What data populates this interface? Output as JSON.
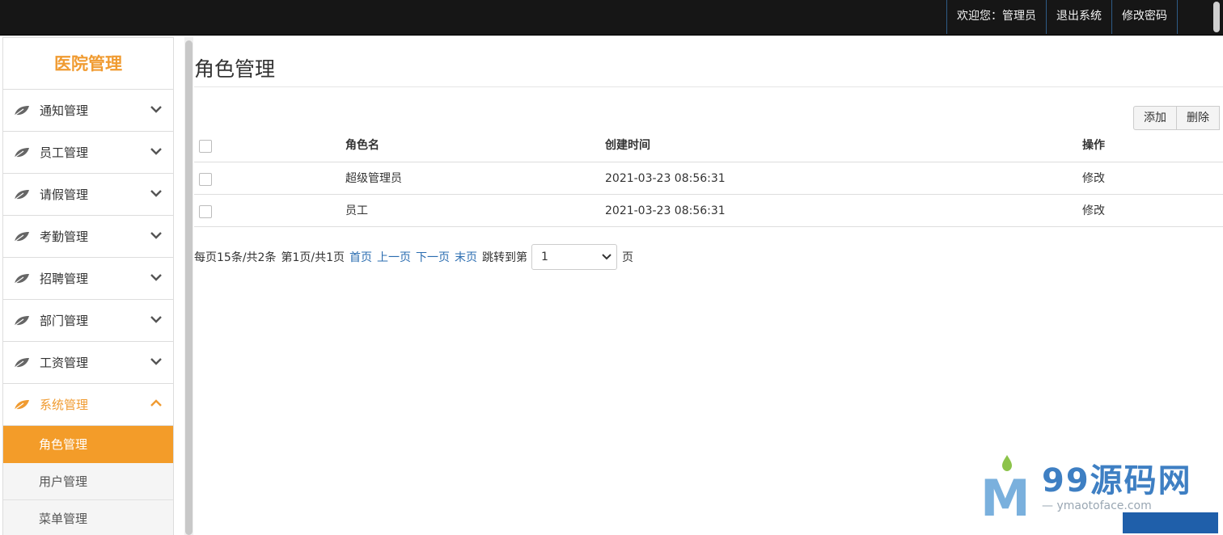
{
  "topbar": {
    "welcome": "欢迎您：管理员",
    "logout": "退出系统",
    "change_password": "修改密码"
  },
  "sidebar": {
    "brand": "医院管理",
    "items": [
      {
        "label": "通知管理",
        "icon": "leaf-icon",
        "expanded": false
      },
      {
        "label": "员工管理",
        "icon": "leaf-icon",
        "expanded": false
      },
      {
        "label": "请假管理",
        "icon": "leaf-icon",
        "expanded": false
      },
      {
        "label": "考勤管理",
        "icon": "leaf-icon",
        "expanded": false
      },
      {
        "label": "招聘管理",
        "icon": "leaf-icon",
        "expanded": false
      },
      {
        "label": "部门管理",
        "icon": "leaf-icon",
        "expanded": false
      },
      {
        "label": "工资管理",
        "icon": "leaf-icon",
        "expanded": false
      },
      {
        "label": "系统管理",
        "icon": "leaf-icon",
        "expanded": true
      }
    ],
    "subitems": [
      {
        "label": "角色管理",
        "active": true
      },
      {
        "label": "用户管理",
        "active": false
      },
      {
        "label": "菜单管理",
        "active": false
      }
    ]
  },
  "main": {
    "title": "角色管理",
    "buttons": {
      "add": "添加",
      "delete": "删除"
    },
    "table": {
      "headers": {
        "name": "角色名",
        "created": "创建时间",
        "action": "操作"
      },
      "rows": [
        {
          "name": "超级管理员",
          "created": "2021-03-23 08:56:31",
          "action": "修改"
        },
        {
          "name": "员工",
          "created": "2021-03-23 08:56:31",
          "action": "修改"
        }
      ]
    },
    "pager": {
      "summary": "每页15条/共2条",
      "page_info": "第1页/共1页",
      "first": "首页",
      "prev": "上一页",
      "next": "下一页",
      "last": "末页",
      "jump_label": "跳转到第",
      "jump_value": "1",
      "jump_suffix": "页"
    }
  },
  "watermark": {
    "logo_letter": "M",
    "title": "99源码网",
    "subtitle": "— ymaotoface.com"
  },
  "colors": {
    "accent": "#f39c29",
    "brand_text": "#f09b31",
    "topbar_bg": "#161616",
    "link": "#2a6cb0"
  }
}
